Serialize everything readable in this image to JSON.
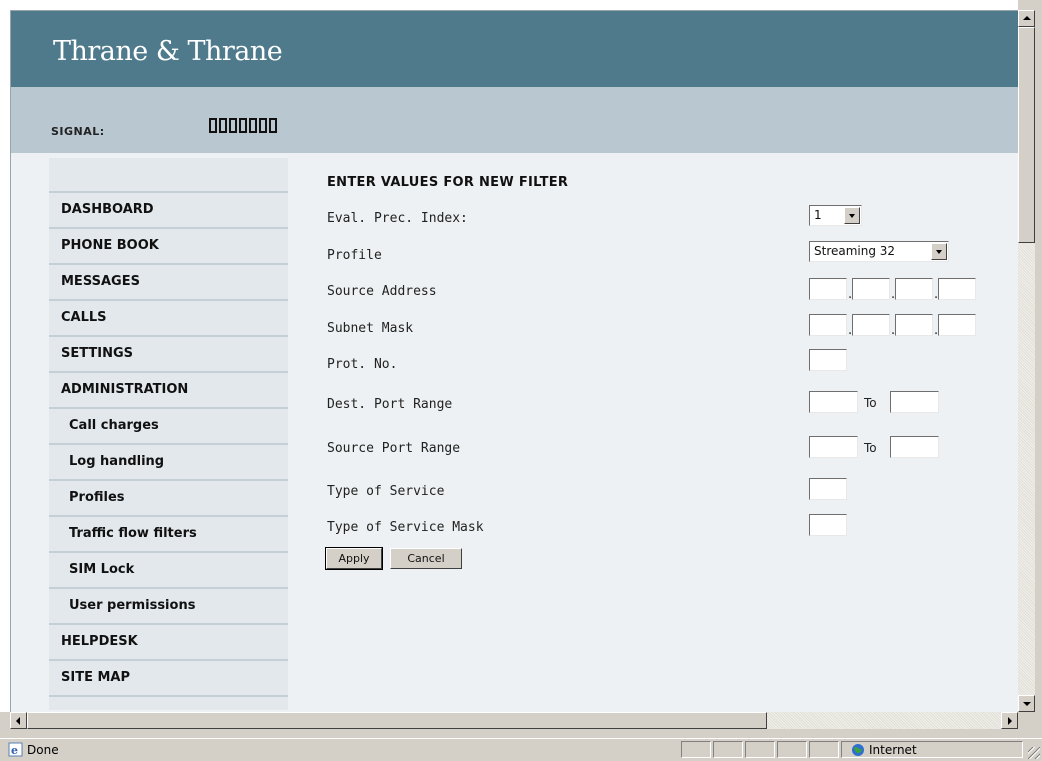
{
  "brand": {
    "logo_text": "Thrane & Thrane"
  },
  "signal": {
    "label": "SIGNAL:",
    "bars": 7
  },
  "nav": {
    "items": [
      {
        "label": "DASHBOARD",
        "sub": false
      },
      {
        "label": "PHONE BOOK",
        "sub": false
      },
      {
        "label": "MESSAGES",
        "sub": false
      },
      {
        "label": "CALLS",
        "sub": false
      },
      {
        "label": "SETTINGS",
        "sub": false
      },
      {
        "label": "ADMINISTRATION",
        "sub": false
      },
      {
        "label": "Call charges",
        "sub": true
      },
      {
        "label": "Log handling",
        "sub": true
      },
      {
        "label": "Profiles",
        "sub": true
      },
      {
        "label": "Traffic flow filters",
        "sub": true
      },
      {
        "label": "SIM Lock",
        "sub": true
      },
      {
        "label": "User permissions",
        "sub": true
      },
      {
        "label": "HELPDESK",
        "sub": false
      },
      {
        "label": "SITE MAP",
        "sub": false
      }
    ]
  },
  "form": {
    "title": "ENTER VALUES FOR NEW FILTER",
    "eval_label": "Eval. Prec. Index:",
    "eval_value": "1",
    "profile_label": "Profile",
    "profile_value": "Streaming 32",
    "source_address_label": "Source Address",
    "source_address": [
      "",
      "",
      "",
      ""
    ],
    "subnet_mask_label": "Subnet Mask",
    "subnet_mask": [
      "",
      "",
      "",
      ""
    ],
    "prot_label": "Prot. No.",
    "prot_value": "",
    "dest_port_label": "Dest. Port Range",
    "dest_port_from": "",
    "dest_port_to": "",
    "source_port_label": "Source Port Range",
    "source_port_from": "",
    "source_port_to": "",
    "to_label": "To",
    "tos_label": "Type of Service",
    "tos_value": "",
    "tos_mask_label": "Type of Service Mask",
    "tos_mask_value": "",
    "apply_label": "Apply",
    "cancel_label": "Cancel"
  },
  "statusbar": {
    "text": "Done",
    "zone": "Internet"
  }
}
